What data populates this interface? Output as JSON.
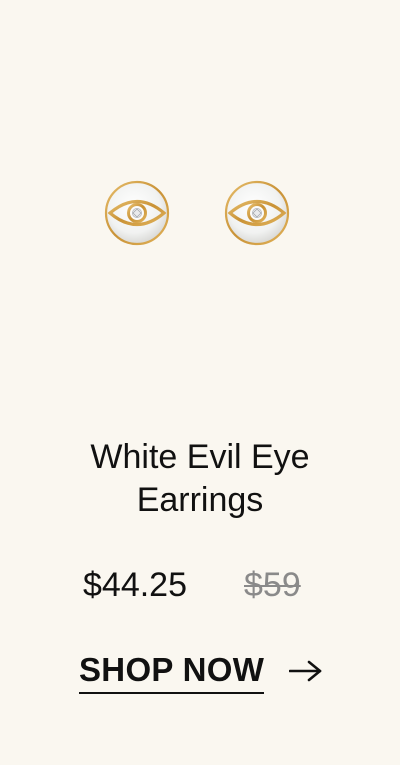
{
  "product": {
    "title_line1": "White Evil Eye",
    "title_line2": "Earrings",
    "sale_price": "$44.25",
    "original_price": "$59",
    "image_icon": "evil-eye-earrings-image"
  },
  "cta": {
    "label": "SHOP NOW",
    "icon": "arrow-right-icon"
  },
  "colors": {
    "background": "#faf7f0",
    "text": "#111111",
    "original_price": "#8a8a8a",
    "gold": "#d3a24a",
    "pearl": "#f3f4f2"
  }
}
